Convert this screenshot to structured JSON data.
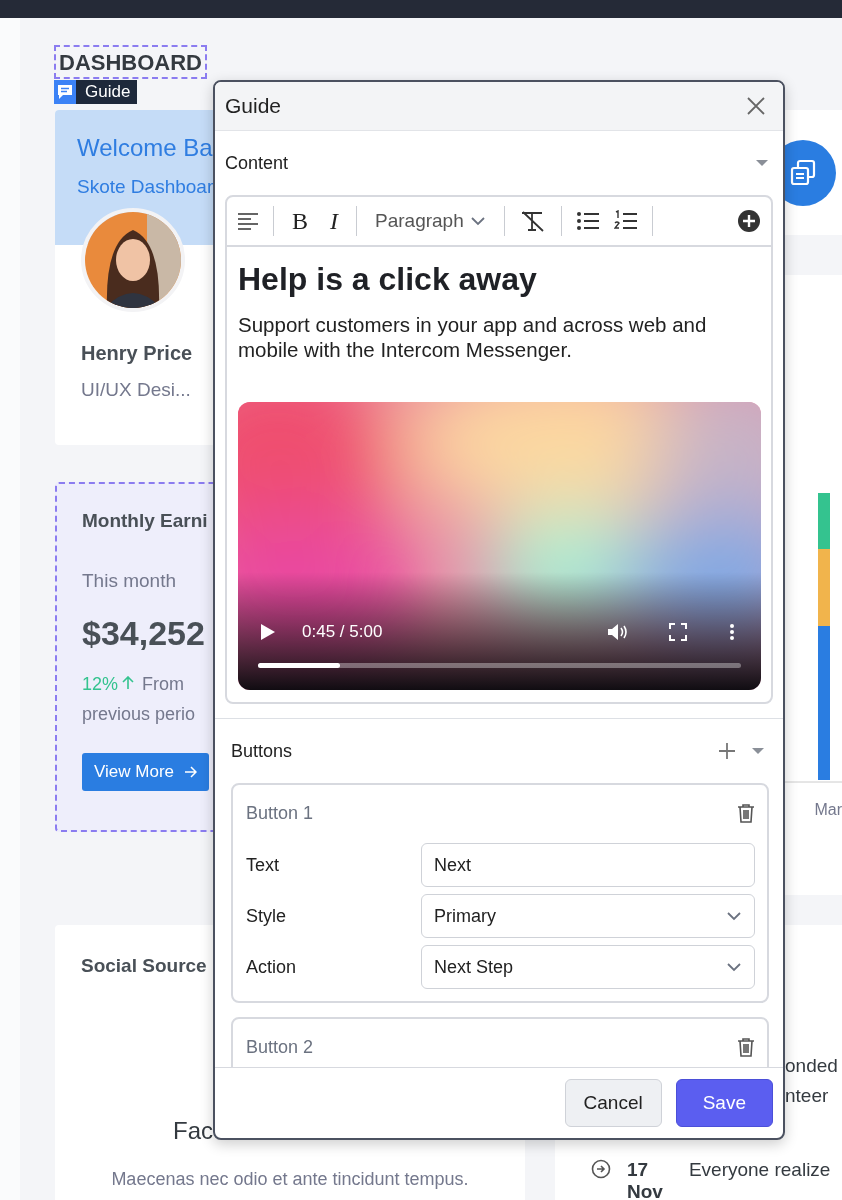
{
  "page_title": "DASHBOARD",
  "guide_tag": "Guide",
  "welcome_card": {
    "title": "Welcome Ba",
    "subtitle": "Skote Dashboar",
    "name": "Henry Price",
    "role": "UI/UX Desi..."
  },
  "earnings_card": {
    "title": "Monthly Earni",
    "period": "This month",
    "amount": "$34,252",
    "change": "12%",
    "note_start": "From",
    "note_rest": "previous perio",
    "button": "View More"
  },
  "chart_card": {
    "axis_label": "Mar"
  },
  "social_card": {
    "title": "Social Source",
    "platform": "Fac",
    "text": "Maecenas nec odio et ante tincidunt tempus."
  },
  "activity": {
    "lines": [
      "onded",
      "nteer"
    ],
    "day": "17",
    "month": "Nov",
    "text": "Everyone realize"
  },
  "modal": {
    "title": "Guide",
    "content_section": {
      "label": "Content",
      "toolbar": [
        {
          "kind": "align"
        },
        {
          "kind": "divider"
        },
        {
          "kind": "bold",
          "label": "B"
        },
        {
          "kind": "italic",
          "label": "I"
        },
        {
          "kind": "divider"
        },
        {
          "kind": "format",
          "label": "Paragraph"
        },
        {
          "kind": "divider"
        },
        {
          "kind": "clear"
        },
        {
          "kind": "divider"
        },
        {
          "kind": "bullets"
        },
        {
          "kind": "numbers"
        },
        {
          "kind": "divider"
        },
        {
          "kind": "insert"
        }
      ],
      "heading": "Help is a click away",
      "paragraph": "Support customers in your app and across web and mobile with the Intercom Messenger.",
      "video": {
        "time": "0:45 / 5:00",
        "level": 0.17
      }
    },
    "buttons_section": {
      "label": "Buttons",
      "items": [
        {
          "title": "Button 1",
          "fields": [
            {
              "label": "Text",
              "value": "Next",
              "kind": "text"
            },
            {
              "label": "Style",
              "value": "Primary",
              "kind": "select"
            },
            {
              "label": "Action",
              "value": "Next Step",
              "kind": "select"
            }
          ]
        },
        {
          "title": "Button 2"
        }
      ]
    },
    "footer": {
      "cancel": "Cancel",
      "save": "Save"
    }
  }
}
